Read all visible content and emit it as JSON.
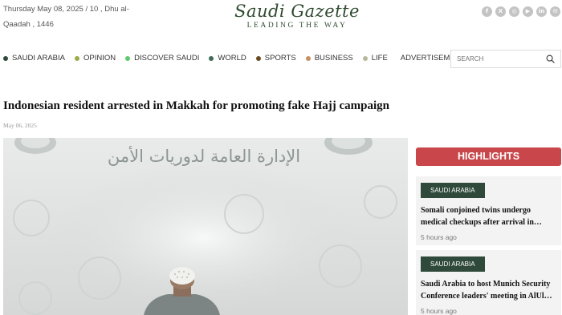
{
  "top_bar": {
    "date_line": "Thursday May 08, 2025 / 10 , Dhu al-Qaadah , 1446"
  },
  "logo": {
    "name": "Saudi Gazette",
    "tagline": "LEADING THE WAY"
  },
  "social": [
    {
      "icon": "facebook-icon",
      "glyph": "f"
    },
    {
      "icon": "x-icon",
      "glyph": "X"
    },
    {
      "icon": "instagram-icon",
      "glyph": "◎"
    },
    {
      "icon": "youtube-icon",
      "glyph": "▶"
    },
    {
      "icon": "linkedin-icon",
      "glyph": "in"
    },
    {
      "icon": "email-icon",
      "glyph": "✉"
    }
  ],
  "nav": {
    "items": [
      {
        "label": "SAUDI ARABIA",
        "dot_color": "#2f4a3a"
      },
      {
        "label": "OPINION",
        "dot_color": "#9aab4a"
      },
      {
        "label": "DISCOVER SAUDI",
        "dot_color": "#5cc96b"
      },
      {
        "label": "WORLD",
        "dot_color": "#3f6a55"
      },
      {
        "label": "SPORTS",
        "dot_color": "#6b4a1f"
      },
      {
        "label": "BUSINESS",
        "dot_color": "#c89060"
      },
      {
        "label": "LIFE",
        "dot_color": "#b8b89a"
      }
    ],
    "advertisements": "ADVERTISEMENTS"
  },
  "search": {
    "placeholder": "SEARCH"
  },
  "article": {
    "headline": "Indonesian resident arrested in Makkah for promoting fake Hajj campaign",
    "date": "May 06, 2025",
    "photo_sign": "الإدارة العامة لدوريات الأمن"
  },
  "sidebar": {
    "banner": "HIGHLIGHTS",
    "cards": [
      {
        "category": "SAUDI ARABIA",
        "title": "Somali conjoined twins undergo medical checkups after arrival in…",
        "ago": "5 hours ago"
      },
      {
        "category": "SAUDI ARABIA",
        "title": "Saudi Arabia to host Munich Security Conference leaders' meeting in AlUl…",
        "ago": "5 hours ago"
      }
    ]
  },
  "colors": {
    "brand_green": "#2f4a3a",
    "highlight_red": "#c9474a"
  }
}
